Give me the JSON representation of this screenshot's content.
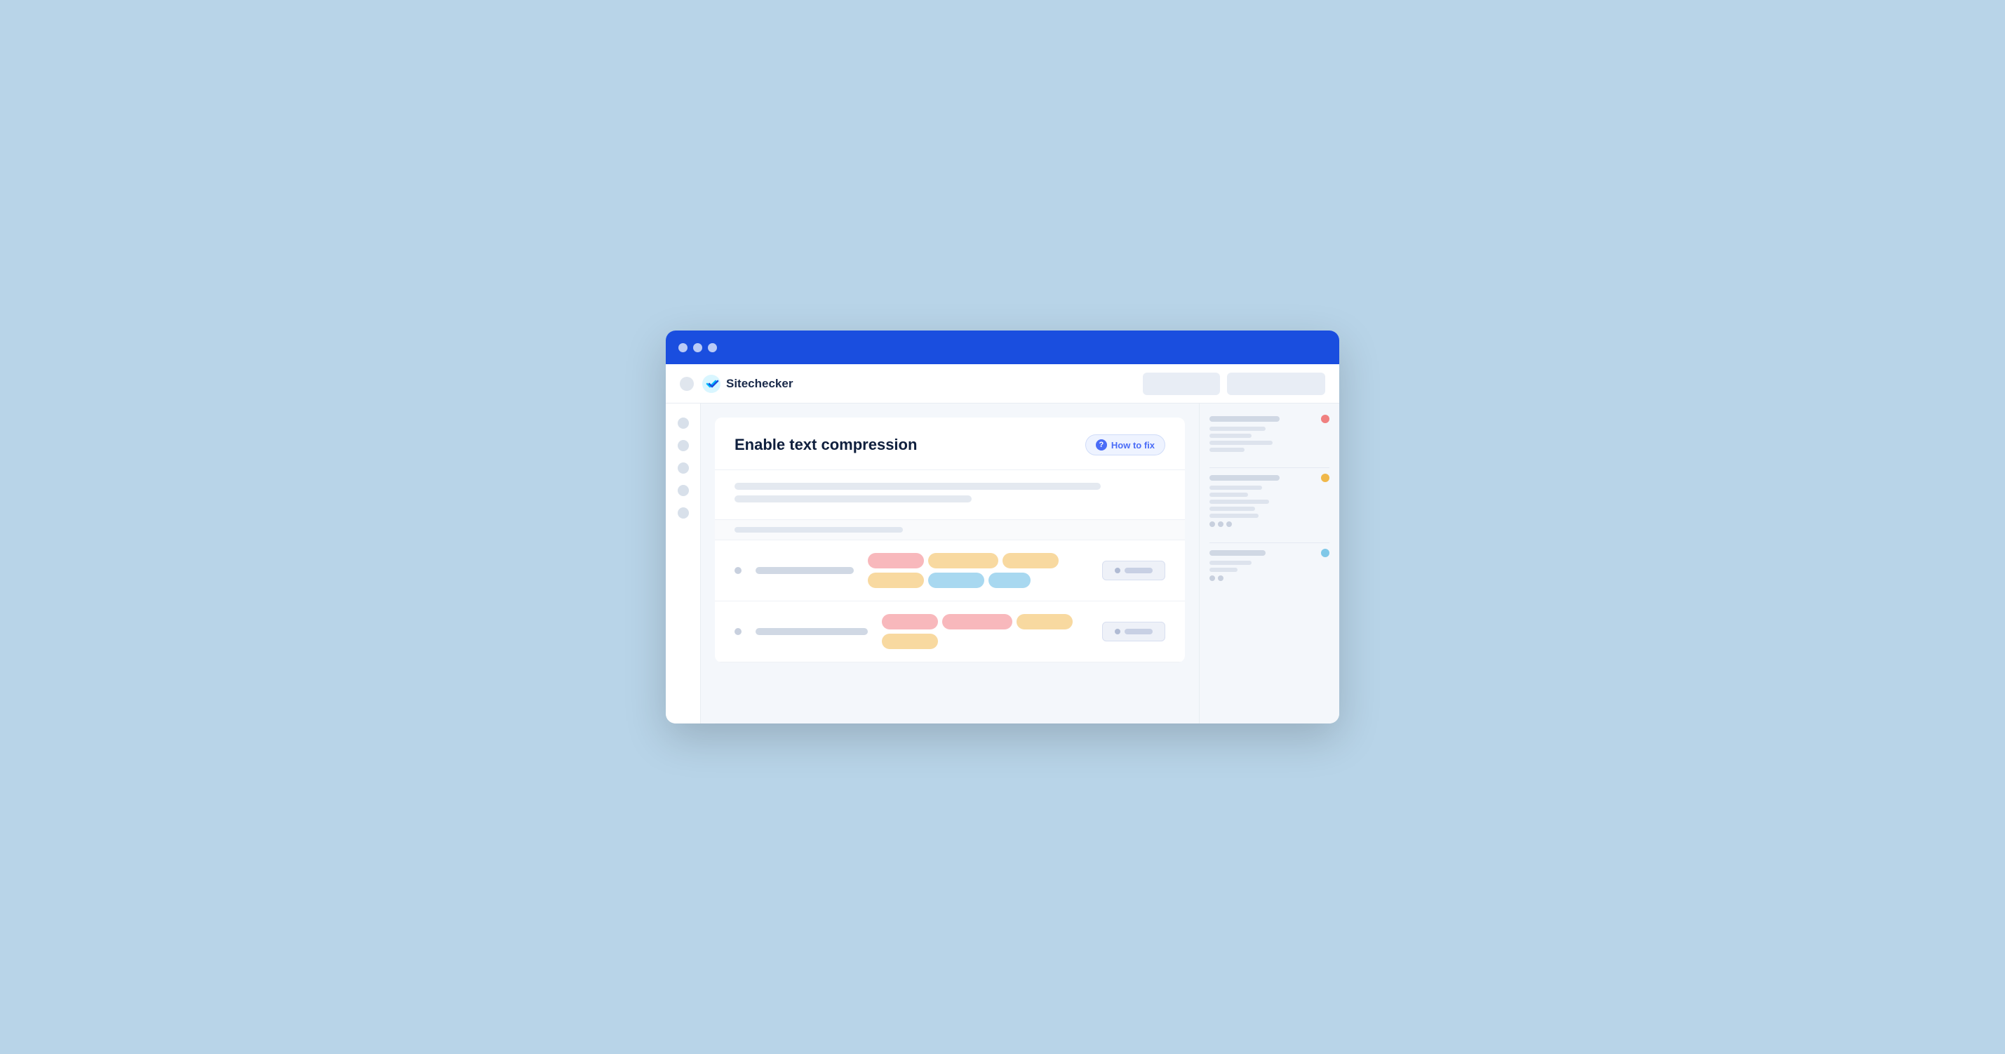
{
  "app": {
    "title": "Sitechecker",
    "logo_icon": "✓"
  },
  "browser": {
    "titlebar_color": "#1a4edf",
    "traffic_lights": [
      "",
      "",
      ""
    ]
  },
  "toolbar": {
    "btn1_label": "",
    "btn2_label": ""
  },
  "card": {
    "title": "Enable text compression",
    "how_to_fix_label": "How to fix",
    "description_lines": [
      "",
      ""
    ],
    "rows": [
      {
        "tags": [
          {
            "color": "pink",
            "size": "md"
          },
          {
            "color": "orange",
            "size": "lg"
          },
          {
            "color": "orange",
            "size": "md"
          },
          {
            "color": "orange",
            "size": "md"
          },
          {
            "color": "blue",
            "size": "md"
          },
          {
            "color": "blue",
            "size": "sm"
          }
        ]
      },
      {
        "tags": [
          {
            "color": "pink",
            "size": "md"
          },
          {
            "color": "pink",
            "size": "lg"
          },
          {
            "color": "orange",
            "size": "md"
          },
          {
            "color": "orange",
            "size": "md"
          }
        ]
      }
    ]
  },
  "right_panel": {
    "sections": [
      {
        "header_line": "long",
        "dot_color": "red",
        "sub_lines": [
          "med",
          "short",
          "med",
          "short"
        ]
      },
      {
        "header_line": "long",
        "dot_color": "orange",
        "sub_lines": [
          "med",
          "short",
          "med",
          "short",
          "med"
        ]
      },
      {
        "header_line": "med",
        "dot_color": "blue",
        "sub_lines": [
          "short",
          "xshort"
        ]
      }
    ]
  },
  "sidebar": {
    "items": [
      {},
      {},
      {},
      {},
      {}
    ]
  }
}
